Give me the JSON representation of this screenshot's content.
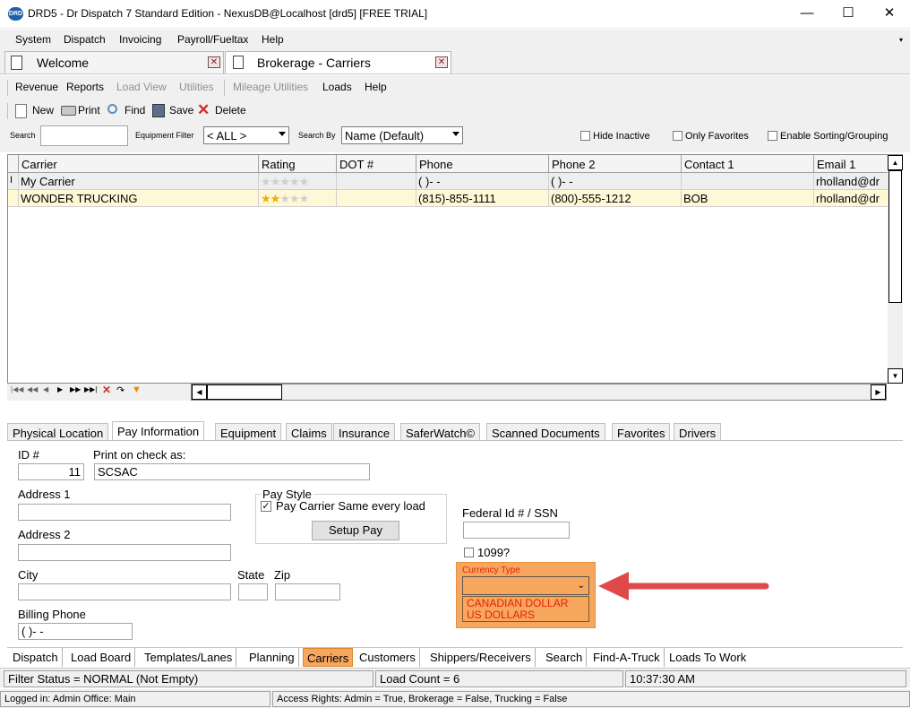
{
  "window": {
    "title": "DRD5 - Dr Dispatch 7 Standard Edition - NexusDB@Localhost [drd5] [FREE TRIAL]",
    "icon_text": "DRD",
    "minimize": "—",
    "maximize": "☐",
    "close": "✕"
  },
  "menu": [
    "System",
    "Dispatch",
    "Invoicing",
    "Payroll/Fueltax",
    "Help"
  ],
  "doc_tabs": [
    {
      "label": "Welcome"
    },
    {
      "label": "Brokerage - Carriers"
    }
  ],
  "toolbar1": {
    "items": [
      {
        "label": "Revenue",
        "enabled": true
      },
      {
        "label": "Reports",
        "enabled": true
      },
      {
        "label": "Load View",
        "enabled": false
      },
      {
        "label": "Utilities",
        "enabled": false
      },
      {
        "label": "Mileage Utilities",
        "enabled": false
      },
      {
        "label": "Loads",
        "enabled": true
      },
      {
        "label": "Help",
        "enabled": true
      }
    ]
  },
  "toolbar2": {
    "new": "New",
    "print": "Print",
    "find": "Find",
    "save": "Save",
    "delete": "Delete"
  },
  "search": {
    "search_label": "Search",
    "search_value": "",
    "equipment_filter_label": "Equipment Filter",
    "equipment_filter_value": "< ALL >",
    "search_by_label": "Search By",
    "search_by_value": "Name (Default)",
    "hide_inactive": "Hide Inactive",
    "only_favorites": "Only Favorites",
    "enable_sorting": "Enable Sorting/Grouping"
  },
  "grid": {
    "columns": [
      "Carrier",
      "Rating",
      "DOT #",
      "Phone",
      "Phone 2",
      "Contact 1",
      "Email 1"
    ],
    "rows": [
      {
        "indicator": "I",
        "carrier": "My Carrier",
        "rating": 0,
        "dot": "",
        "phone": "(   )-   -",
        "phone2": "(   )-   -",
        "contact": "",
        "email": "rholland@dr"
      },
      {
        "indicator": "",
        "carrier": "WONDER TRUCKING",
        "rating": 2,
        "dot": "",
        "phone": "(815)-855-1111",
        "phone2": "(800)-555-1212",
        "contact": "BOB",
        "email": "rholland@dr"
      }
    ]
  },
  "detail_tabs": [
    "Physical Location",
    "Pay Information",
    "Equipment",
    "Claims",
    "Insurance",
    "SaferWatch©",
    "Scanned Documents",
    "Favorites",
    "Drivers"
  ],
  "pay_info": {
    "id_label": "ID #",
    "id_value": "11",
    "print_check_label": "Print on check as:",
    "print_check_value": "SCSAC",
    "address1_label": "Address 1",
    "address2_label": "Address 2",
    "city_label": "City",
    "state_label": "State",
    "zip_label": "Zip",
    "billing_phone_label": "Billing Phone",
    "billing_phone_value": "(   )-   -",
    "pay_style_label": "Pay Style",
    "pay_same_label": "Pay Carrier Same every load",
    "setup_pay": "Setup Pay",
    "federal_id_label": "Federal Id # / SSN",
    "label_1099": "1099?",
    "currency_type_label": "Currency Type",
    "currency_options": [
      "CANADIAN DOLLAR",
      "US DOLLARS"
    ]
  },
  "bottom_tabs": [
    "Dispatch",
    "Load Board",
    "Templates/Lanes",
    "Planning",
    "Carriers",
    "Customers",
    "Shippers/Receivers",
    "Search",
    "Find-A-Truck",
    "Loads To Work"
  ],
  "status": {
    "filter": "Filter Status = NORMAL (Not Empty)",
    "load_count": "Load Count = 6",
    "time": "10:37:30 AM",
    "logged_in": "Logged in: Admin Office: Main",
    "access": "Access Rights: Admin = True, Brokerage = False, Trucking = False"
  },
  "colors": {
    "highlight": "#f7a65d",
    "arrow": "#e0494a",
    "currency_text": "#e8200c"
  }
}
